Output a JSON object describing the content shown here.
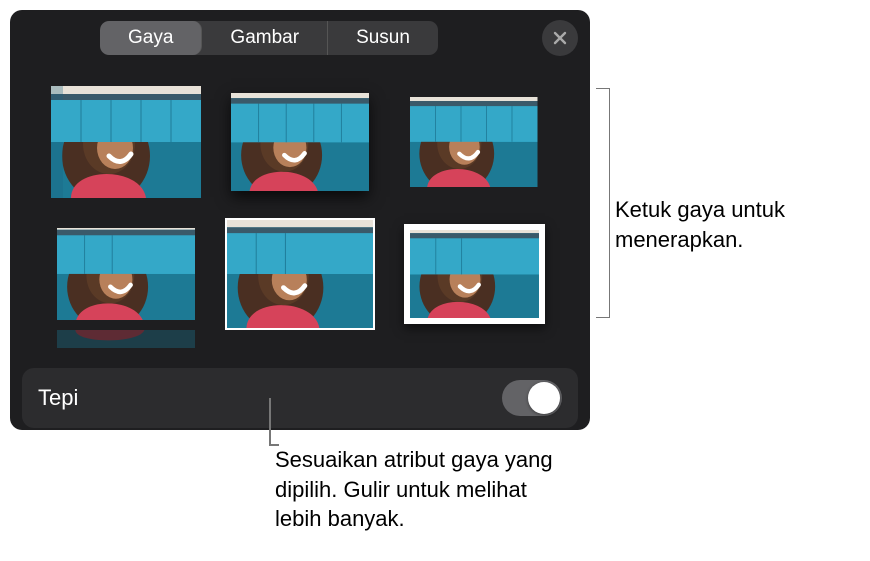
{
  "tabs": {
    "style": "Gaya",
    "image": "Gambar",
    "arrange": "Susun",
    "active_index": 0
  },
  "controls": {
    "border_label": "Tepi",
    "border_on": true
  },
  "callouts": {
    "styles": "Ketuk gaya untuk menerapkan.",
    "attributes": "Sesuaikan atribut gaya yang dipilih. Gulir untuk melihat lebih banyak."
  },
  "styles": [
    {
      "id": "plain"
    },
    {
      "id": "shadow"
    },
    {
      "id": "small"
    },
    {
      "id": "reflect"
    },
    {
      "id": "thin-border"
    },
    {
      "id": "thick-border"
    }
  ]
}
